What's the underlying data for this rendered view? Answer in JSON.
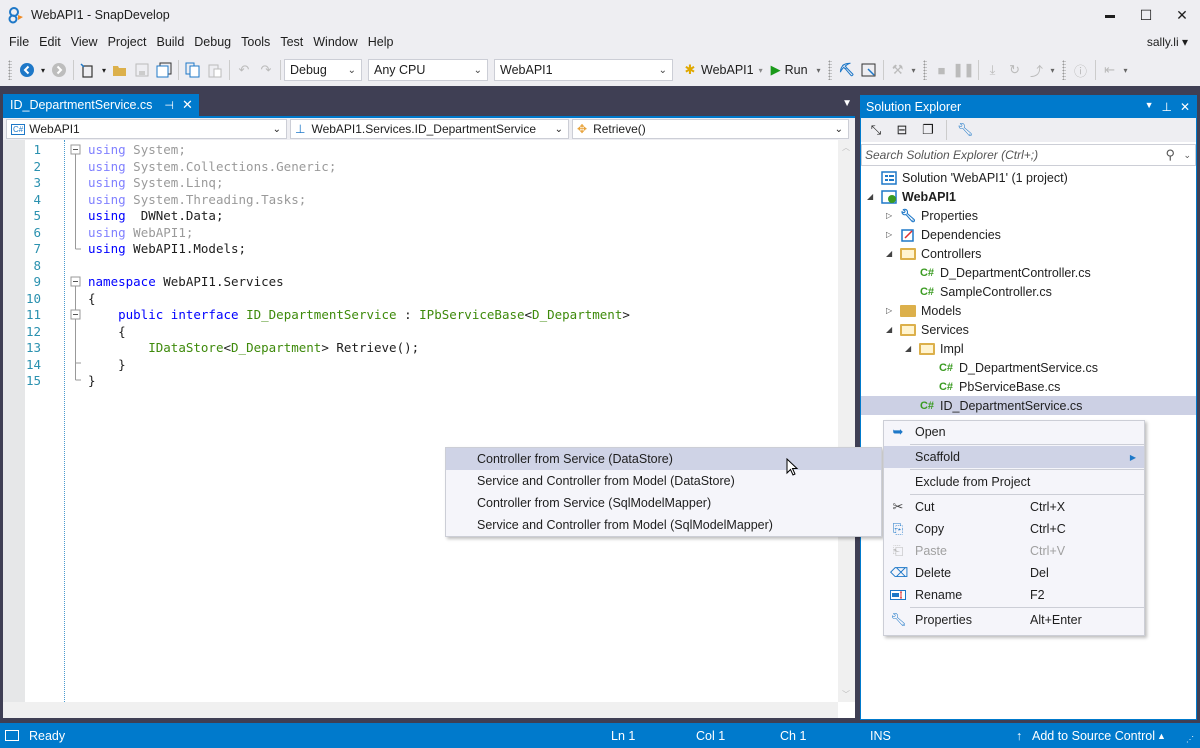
{
  "window": {
    "title": "WebAPI1 - SnapDevelop",
    "controls": {
      "minimize": "▬",
      "maximize": "☐",
      "close": "✕"
    }
  },
  "menu": {
    "items": [
      "File",
      "Edit",
      "View",
      "Project",
      "Build",
      "Debug",
      "Tools",
      "Test",
      "Window",
      "Help"
    ],
    "user": "sally.li ▾"
  },
  "toolbar": {
    "config": "Debug",
    "platform": "Any CPU",
    "project": "WebAPI1",
    "debug_target": "WebAPI1",
    "run_label": "Run"
  },
  "editor": {
    "tab_title": "ID_DepartmentService.cs",
    "nav_project": "WebAPI1",
    "nav_type": "WebAPI1.Services.ID_DepartmentService",
    "nav_member": "Retrieve()",
    "lines": [
      {
        "n": "1",
        "parts": [
          [
            "kwd",
            "using"
          ],
          [
            "dim",
            " System;"
          ]
        ]
      },
      {
        "n": "2",
        "parts": [
          [
            "kwd",
            "using"
          ],
          [
            "dim",
            " System.Collections.Generic;"
          ]
        ]
      },
      {
        "n": "3",
        "parts": [
          [
            "kwd",
            "using"
          ],
          [
            "dim",
            " System.Linq;"
          ]
        ]
      },
      {
        "n": "4",
        "parts": [
          [
            "kwd",
            "using"
          ],
          [
            "dim",
            " System.Threading.Tasks;"
          ]
        ]
      },
      {
        "n": "5",
        "parts": [
          [
            "kw",
            "using"
          ],
          [
            "",
            "  DWNet.Data;"
          ]
        ]
      },
      {
        "n": "6",
        "parts": [
          [
            "kwd",
            "using"
          ],
          [
            "dim",
            " WebAPI1;"
          ]
        ]
      },
      {
        "n": "7",
        "parts": [
          [
            "kw",
            "using"
          ],
          [
            "",
            " WebAPI1.Models;"
          ]
        ]
      },
      {
        "n": "8",
        "parts": []
      },
      {
        "n": "9",
        "parts": [
          [
            "kw",
            "namespace"
          ],
          [
            "",
            " WebAPI1.Services"
          ]
        ]
      },
      {
        "n": "10",
        "parts": [
          [
            "",
            "{"
          ]
        ]
      },
      {
        "n": "11",
        "parts": [
          [
            "",
            "    "
          ],
          [
            "kw",
            "public"
          ],
          [
            "",
            " "
          ],
          [
            "kw",
            "interface"
          ],
          [
            "",
            " "
          ],
          [
            "gr",
            "ID_DepartmentService"
          ],
          [
            "",
            " : "
          ],
          [
            "gr",
            "IPbServiceBase"
          ],
          [
            "",
            "<"
          ],
          [
            "gr",
            "D_Department"
          ],
          [
            "",
            ">"
          ]
        ]
      },
      {
        "n": "12",
        "parts": [
          [
            "",
            "    {"
          ]
        ]
      },
      {
        "n": "13",
        "parts": [
          [
            "",
            "        "
          ],
          [
            "gr",
            "IDataStore"
          ],
          [
            "",
            "<"
          ],
          [
            "gr",
            "D_Department"
          ],
          [
            "",
            "> Retrieve();"
          ]
        ]
      },
      {
        "n": "14",
        "parts": [
          [
            "",
            "    }"
          ]
        ]
      },
      {
        "n": "15",
        "parts": [
          [
            "",
            "}"
          ]
        ]
      }
    ]
  },
  "solution_explorer": {
    "title": "Solution Explorer",
    "search_placeholder": "Search Solution Explorer (Ctrl+;)",
    "tree": [
      {
        "label": "Solution 'WebAPI1' (1 project)",
        "icon": "solution",
        "level": 0,
        "exp": ""
      },
      {
        "label": "WebAPI1",
        "icon": "project",
        "level": 0,
        "exp": "◢",
        "bold": true
      },
      {
        "label": "Properties",
        "icon": "wrench",
        "level": 1,
        "exp": "▷"
      },
      {
        "label": "Dependencies",
        "icon": "deps",
        "level": 1,
        "exp": "▷"
      },
      {
        "label": "Controllers",
        "icon": "folder-open",
        "level": 1,
        "exp": "◢"
      },
      {
        "label": "D_DepartmentController.cs",
        "icon": "cs",
        "level": 2,
        "exp": ""
      },
      {
        "label": "SampleController.cs",
        "icon": "cs",
        "level": 2,
        "exp": ""
      },
      {
        "label": "Models",
        "icon": "folder",
        "level": 1,
        "exp": "▷"
      },
      {
        "label": "Services",
        "icon": "folder-open",
        "level": 1,
        "exp": "◢"
      },
      {
        "label": "Impl",
        "icon": "folder-open",
        "level": 2,
        "exp": "◢"
      },
      {
        "label": "D_DepartmentService.cs",
        "icon": "cs",
        "level": 3,
        "exp": ""
      },
      {
        "label": "PbServiceBase.cs",
        "icon": "cs",
        "level": 3,
        "exp": ""
      },
      {
        "label": "ID_DepartmentService.cs",
        "icon": "cs",
        "level": 2,
        "exp": "",
        "selected": true
      }
    ]
  },
  "context_menu": {
    "items": [
      {
        "label": "Open",
        "icon": "open",
        "shortcut": ""
      },
      {
        "sep": true
      },
      {
        "label": "Scaffold",
        "icon": "",
        "shortcut": "",
        "submenu": true,
        "highlight": true
      },
      {
        "sep": true
      },
      {
        "label": "Exclude from Project",
        "icon": "",
        "shortcut": ""
      },
      {
        "sep": true
      },
      {
        "label": "Cut",
        "icon": "cut",
        "shortcut": "Ctrl+X"
      },
      {
        "label": "Copy",
        "icon": "copy",
        "shortcut": "Ctrl+C"
      },
      {
        "label": "Paste",
        "icon": "paste",
        "shortcut": "Ctrl+V",
        "disabled": true
      },
      {
        "label": "Delete",
        "icon": "delete",
        "shortcut": "Del"
      },
      {
        "label": "Rename",
        "icon": "rename",
        "shortcut": "F2"
      },
      {
        "sep": true
      },
      {
        "label": "Properties",
        "icon": "wrench",
        "shortcut": "Alt+Enter"
      }
    ]
  },
  "scaffold_submenu": {
    "items": [
      "Controller from Service  (DataStore)",
      "Service and Controller from Model (DataStore)",
      "Controller from Service (SqlModelMapper)",
      "Service and Controller from Model (SqlModelMapper)"
    ],
    "highlighted_index": 0
  },
  "status": {
    "state": "Ready",
    "ln": "Ln 1",
    "col": "Col 1",
    "ch": "Ch 1",
    "mode": "INS",
    "source_control": "Add to Source Control"
  },
  "colors": {
    "accent": "#007acc",
    "chrome": "#eeeef2",
    "frame": "#3f3f54"
  }
}
